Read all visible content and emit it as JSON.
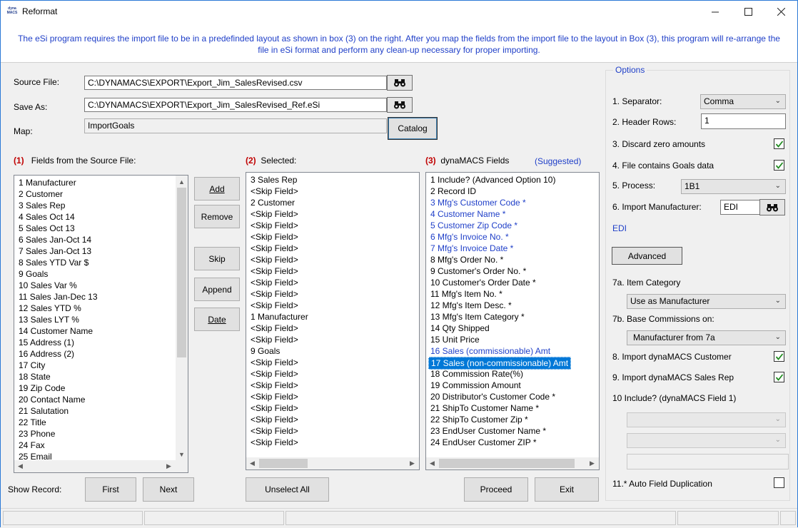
{
  "window": {
    "title": "Reformat",
    "logo_text": "dyna MACS"
  },
  "banner": {
    "text": "The eSi program requires the import file to be in a predefinded layout as shown in box (3) on the right. After you map the fields from the import file to the layout in Box (3), this program will re-arrange the file in eSi format and perform any clean-up necessary for proper importing."
  },
  "source": {
    "source_label": "Source File:",
    "source_value": "C:\\DYNAMACS\\EXPORT\\Export_Jim_SalesRevised.csv",
    "saveas_label": "Save As:",
    "saveas_value": "C:\\DYNAMACS\\EXPORT\\Export_Jim_SalesRevised_Ref.eSi",
    "map_label": "Map:",
    "map_value": "ImportGoals",
    "catalog_label": "Catalog"
  },
  "box1": {
    "num": "(1)",
    "title": "Fields from the Source File:",
    "items": [
      "1 Manufacturer",
      "2 Customer",
      "3 Sales Rep",
      "4 Sales Oct 14",
      "5 Sales Oct 13",
      "6 Sales Jan-Oct 14",
      "7 Sales Jan-Oct 13",
      "8 Sales YTD Var $",
      "9 Goals",
      "10 Sales Var %",
      "11 Sales Jan-Dec 13",
      "12 Sales YTD %",
      "13 Sales LYT %",
      "14 Customer Name",
      "15 Address (1)",
      "16 Address (2)",
      "17 City",
      "18 State",
      "19 Zip Code",
      "20 Contact Name",
      "21 Salutation",
      "22 Title",
      "23 Phone",
      "24 Fax",
      "25 Email"
    ]
  },
  "middle_buttons": {
    "add": "Add",
    "remove": "Remove",
    "skip": "Skip",
    "append": "Append",
    "date": "Date"
  },
  "box2": {
    "num": "(2)",
    "title": "Selected:",
    "items": [
      " 3 Sales Rep",
      "<Skip Field>",
      " 2 Customer",
      "<Skip Field>",
      "<Skip Field>",
      "<Skip Field>",
      "<Skip Field>",
      "<Skip Field>",
      "<Skip Field>",
      "<Skip Field>",
      "<Skip Field>",
      "<Skip Field>",
      " 1 Manufacturer",
      "<Skip Field>",
      "<Skip Field>",
      " 9 Goals",
      "<Skip Field>",
      "<Skip Field>",
      "<Skip Field>",
      "<Skip Field>",
      "<Skip Field>",
      "<Skip Field>",
      "<Skip Field>",
      "<Skip Field>"
    ]
  },
  "box3": {
    "num": "(3)",
    "title": "dynaMACS Fields",
    "suggested": "(Suggested)",
    "items": [
      {
        "text": "1 Include? (Advanced Option 10)",
        "style": "normal"
      },
      {
        "text": "2 Record ID",
        "style": "normal"
      },
      {
        "text": "3 Mfg's Customer Code *",
        "style": "blue"
      },
      {
        "text": "4 Customer Name *",
        "style": "blue"
      },
      {
        "text": "5 Customer Zip Code *",
        "style": "blue"
      },
      {
        "text": "6 Mfg's Invoice No. *",
        "style": "blue"
      },
      {
        "text": "7 Mfg's Invoice Date *",
        "style": "blue"
      },
      {
        "text": "8 Mfg's Order No. *",
        "style": "normal"
      },
      {
        "text": "9 Customer's Order No. *",
        "style": "normal"
      },
      {
        "text": "10 Customer's Order Date *",
        "style": "normal"
      },
      {
        "text": "11 Mfg's Item No. *",
        "style": "normal"
      },
      {
        "text": "12 Mfg's Item Desc. *",
        "style": "normal"
      },
      {
        "text": "13 Mfg's Item Category *",
        "style": "normal"
      },
      {
        "text": "14 Qty Shipped",
        "style": "normal"
      },
      {
        "text": "15 Unit Price",
        "style": "normal"
      },
      {
        "text": "16 Sales (commissionable) Amt",
        "style": "blue"
      },
      {
        "text": "17 Sales (non-commissionable) Amt",
        "style": "selected"
      },
      {
        "text": "18 Commission Rate(%)",
        "style": "normal"
      },
      {
        "text": "19 Commission Amount",
        "style": "normal"
      },
      {
        "text": "20 Distributor's Customer Code *",
        "style": "normal"
      },
      {
        "text": "21 ShipTo Customer Name *",
        "style": "normal"
      },
      {
        "text": "22 ShipTo Customer Zip *",
        "style": "normal"
      },
      {
        "text": "23 EndUser Customer Name *",
        "style": "normal"
      },
      {
        "text": "24 EndUser Customer ZIP *",
        "style": "normal"
      }
    ]
  },
  "bottom": {
    "show_record": "Show Record:",
    "first": "First",
    "next": "Next",
    "unselect_all": "Unselect All",
    "proceed": "Proceed",
    "exit": "Exit"
  },
  "options": {
    "title": "Options",
    "separator_label": "1. Separator:",
    "separator_value": "Comma",
    "header_rows_label": "2. Header Rows:",
    "header_rows_value": "1",
    "discard_label": "3. Discard zero amounts",
    "discard_checked": true,
    "goals_label": "4. File contains Goals data",
    "goals_checked": true,
    "process_label": "5. Process:",
    "process_value": "1B1",
    "import_mfr_label": "6. Import Manufacturer:",
    "import_mfr_value": "EDI",
    "edi_text": "EDI",
    "advanced_label": "Advanced",
    "item_cat_label": "7a. Item Category",
    "item_cat_value": "Use as Manufacturer",
    "base_comm_label": "7b. Base Commissions on:",
    "base_comm_value": "Manufacturer from 7a",
    "import_cust_label": "8.  Import dynaMACS Customer",
    "import_cust_checked": true,
    "import_rep_label": "9.  Import dynaMACS Sales Rep",
    "import_rep_checked": true,
    "include_label": "10 Include? (dynaMACS Field 1)",
    "auto_dup_label": "11.* Auto Field Duplication",
    "auto_dup_checked": false
  },
  "colors": {
    "accent": "#1f3fc8",
    "highlight": "#0078d7",
    "red": "#c00000",
    "check": "#1e8a1e"
  }
}
